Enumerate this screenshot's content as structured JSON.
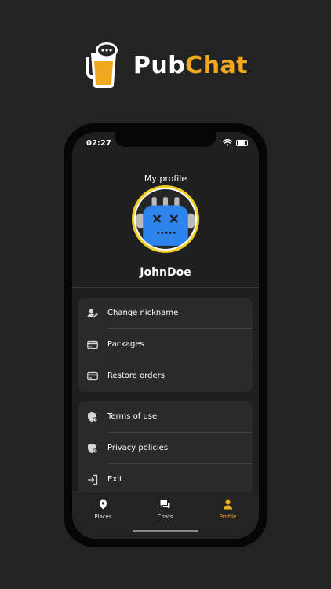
{
  "brand": {
    "name_part1": "Pub",
    "name_part2": "Chat",
    "accent": "#f0a81c"
  },
  "status": {
    "time": "02:27",
    "wifi_icon": "wifi-icon",
    "battery_icon": "battery-icon"
  },
  "profile": {
    "title": "My profile",
    "username": "JohnDoe",
    "avatar": {
      "ring_color": "#f1ce1f",
      "robot_color": "#2c84ec"
    }
  },
  "menu": {
    "group1": [
      {
        "label": "Change nickname",
        "icon": "user-edit-icon"
      },
      {
        "label": "Packages",
        "icon": "card-icon"
      },
      {
        "label": "Restore orders",
        "icon": "card-icon"
      }
    ],
    "group2": [
      {
        "label": "Terms of use",
        "icon": "shield-icon"
      },
      {
        "label": "Privacy policies",
        "icon": "shield-icon"
      },
      {
        "label": "Exit",
        "icon": "exit-icon"
      }
    ]
  },
  "tabs": [
    {
      "label": "Places",
      "icon": "location-pin-icon",
      "active": false
    },
    {
      "label": "Chats",
      "icon": "chat-bubbles-icon",
      "active": false
    },
    {
      "label": "Profile",
      "icon": "person-icon",
      "active": true
    }
  ],
  "colors": {
    "background": "#232323",
    "active_tab": "#f0b21e"
  }
}
